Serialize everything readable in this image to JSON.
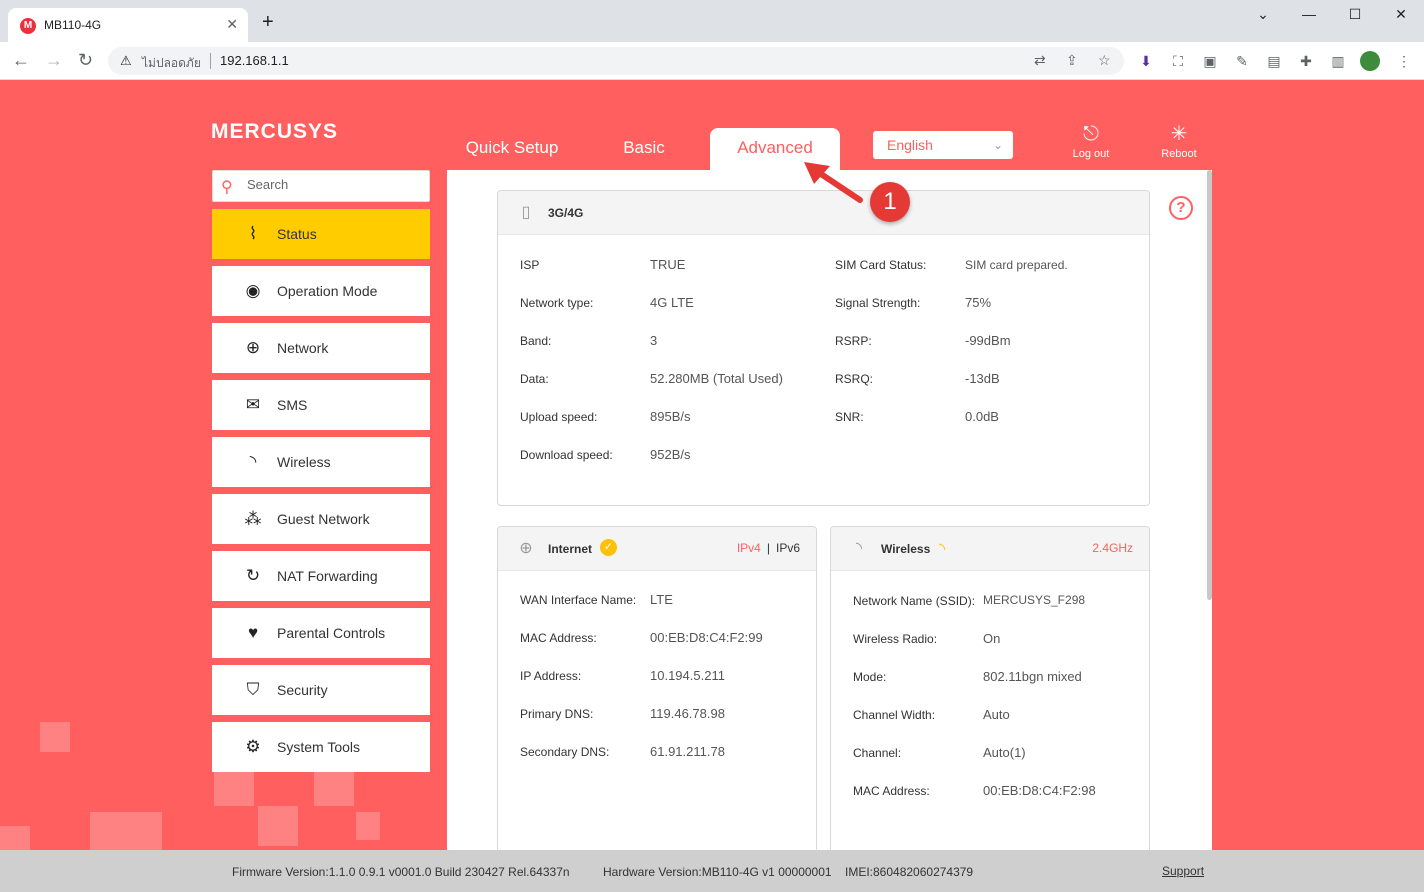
{
  "browser": {
    "tab_title": "MB110-4G",
    "favicon_letter": "M",
    "security_label": "ไม่ปลอดภัย",
    "url": "192.168.1.1"
  },
  "header": {
    "logo": "MERCUSYS",
    "tabs": [
      "Quick Setup",
      "Basic",
      "Advanced"
    ],
    "active_tab": "Advanced",
    "language": "English",
    "logout_label": "Log out",
    "reboot_label": "Reboot"
  },
  "search": {
    "placeholder": "Search"
  },
  "sidebar": {
    "items": [
      {
        "label": "Status",
        "icon": "pulse-icon"
      },
      {
        "label": "Operation Mode",
        "icon": "toggle-icon"
      },
      {
        "label": "Network",
        "icon": "globe-icon"
      },
      {
        "label": "SMS",
        "icon": "envelope-icon"
      },
      {
        "label": "Wireless",
        "icon": "wifi-icon"
      },
      {
        "label": "Guest Network",
        "icon": "guests-icon"
      },
      {
        "label": "NAT Forwarding",
        "icon": "nat-icon"
      },
      {
        "label": "Parental Controls",
        "icon": "heart-icon"
      },
      {
        "label": "Security",
        "icon": "shield-icon"
      },
      {
        "label": "System Tools",
        "icon": "gear-icon"
      }
    ]
  },
  "cellular": {
    "title": "3G/4G",
    "left": [
      {
        "label": "ISP",
        "value": "TRUE"
      },
      {
        "label": "Network type:",
        "value": "4G LTE"
      },
      {
        "label": "Band:",
        "value": "3"
      },
      {
        "label": "Data:",
        "value": "52.280MB (Total Used)"
      },
      {
        "label": "Upload speed:",
        "value": "895B/s"
      },
      {
        "label": "Download speed:",
        "value": "952B/s"
      }
    ],
    "right": [
      {
        "label": "SIM Card Status:",
        "value": "SIM card prepared."
      },
      {
        "label": "Signal Strength:",
        "value": "75%"
      },
      {
        "label": "RSRP:",
        "value": "-99dBm"
      },
      {
        "label": "RSRQ:",
        "value": "-13dB"
      },
      {
        "label": "SNR:",
        "value": "0.0dB"
      }
    ]
  },
  "internet": {
    "title": "Internet",
    "ipv4": "IPv4",
    "ipv6": "IPv6",
    "rows": [
      {
        "label": "WAN Interface Name:",
        "value": "LTE"
      },
      {
        "label": "MAC Address:",
        "value": "00:EB:D8:C4:F2:99"
      },
      {
        "label": "IP Address:",
        "value": "10.194.5.211"
      },
      {
        "label": "Primary DNS:",
        "value": "119.46.78.98"
      },
      {
        "label": "Secondary DNS:",
        "value": "61.91.211.78"
      }
    ]
  },
  "wireless": {
    "title": "Wireless",
    "band": "2.4GHz",
    "rows": [
      {
        "label": "Network Name (SSID):",
        "value": "MERCUSYS_F298"
      },
      {
        "label": "Wireless Radio:",
        "value": "On"
      },
      {
        "label": "Mode:",
        "value": "802.11bgn mixed"
      },
      {
        "label": "Channel Width:",
        "value": "Auto"
      },
      {
        "label": "Channel:",
        "value": "Auto(1)"
      },
      {
        "label": "MAC Address:",
        "value": "00:EB:D8:C4:F2:98"
      }
    ]
  },
  "annotation": {
    "step": "1"
  },
  "footer": {
    "firmware": "Firmware Version:1.1.0 0.9.1 v0001.0 Build 230427 Rel.64337n",
    "hardware": "Hardware Version:MB110-4G v1 00000001",
    "imei": "IMEI:860482060274379",
    "support": "Support"
  },
  "colors": {
    "accent": "#ff5f5f",
    "active_item": "#ffcc00"
  }
}
